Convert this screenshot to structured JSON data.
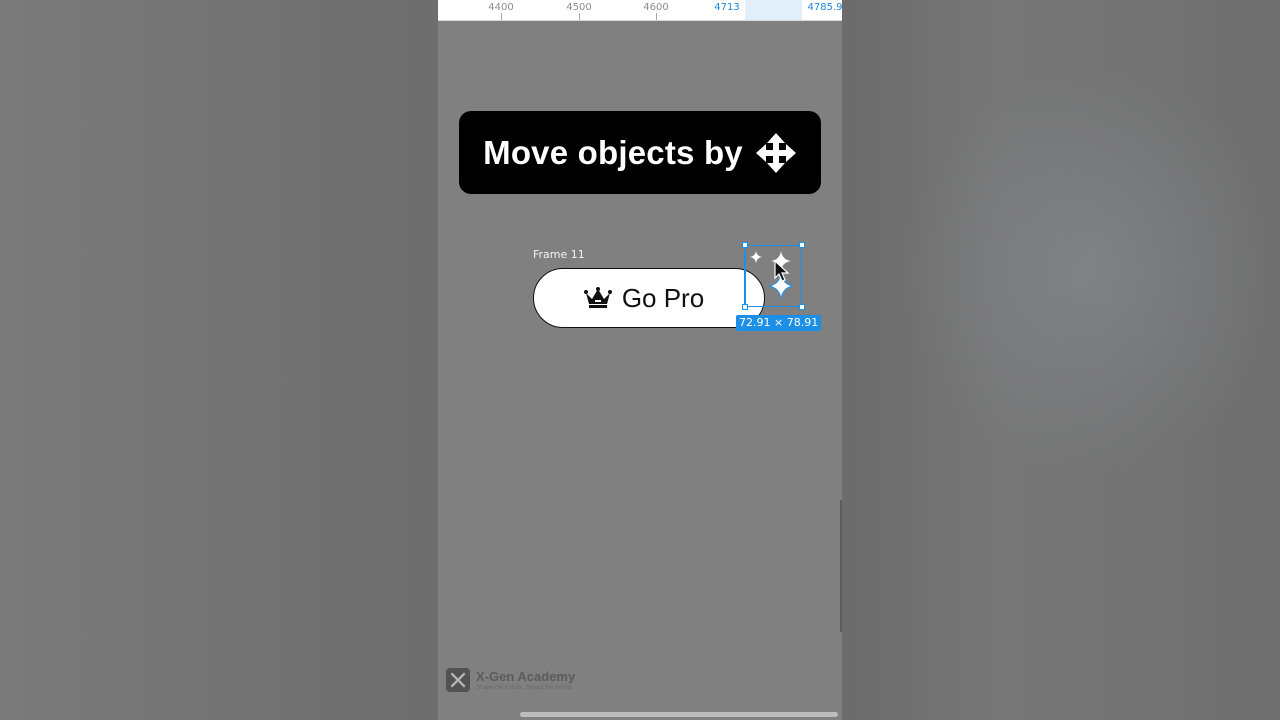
{
  "ruler": {
    "ticks": [
      {
        "label": "4400",
        "selected": false
      },
      {
        "label": "4500",
        "selected": false
      },
      {
        "label": "4600",
        "selected": false
      },
      {
        "label": "4713",
        "selected": true
      },
      {
        "label": "4785.9",
        "selected": true
      }
    ]
  },
  "banner": {
    "text": "Move objects by",
    "icon": "move-arrows-icon"
  },
  "frame": {
    "label": "Frame 11",
    "button_text": "Go Pro",
    "button_icon": "crown-icon"
  },
  "selection": {
    "dimensions": "72.91 × 78.91",
    "content_icon": "sparkles-icon"
  },
  "watermark": {
    "title": "X-Gen Academy",
    "subtitle": "Shape the Future, Impact the World."
  },
  "colors": {
    "selection": "#1d8fe6",
    "canvas": "#808080",
    "banner": "#000000"
  }
}
